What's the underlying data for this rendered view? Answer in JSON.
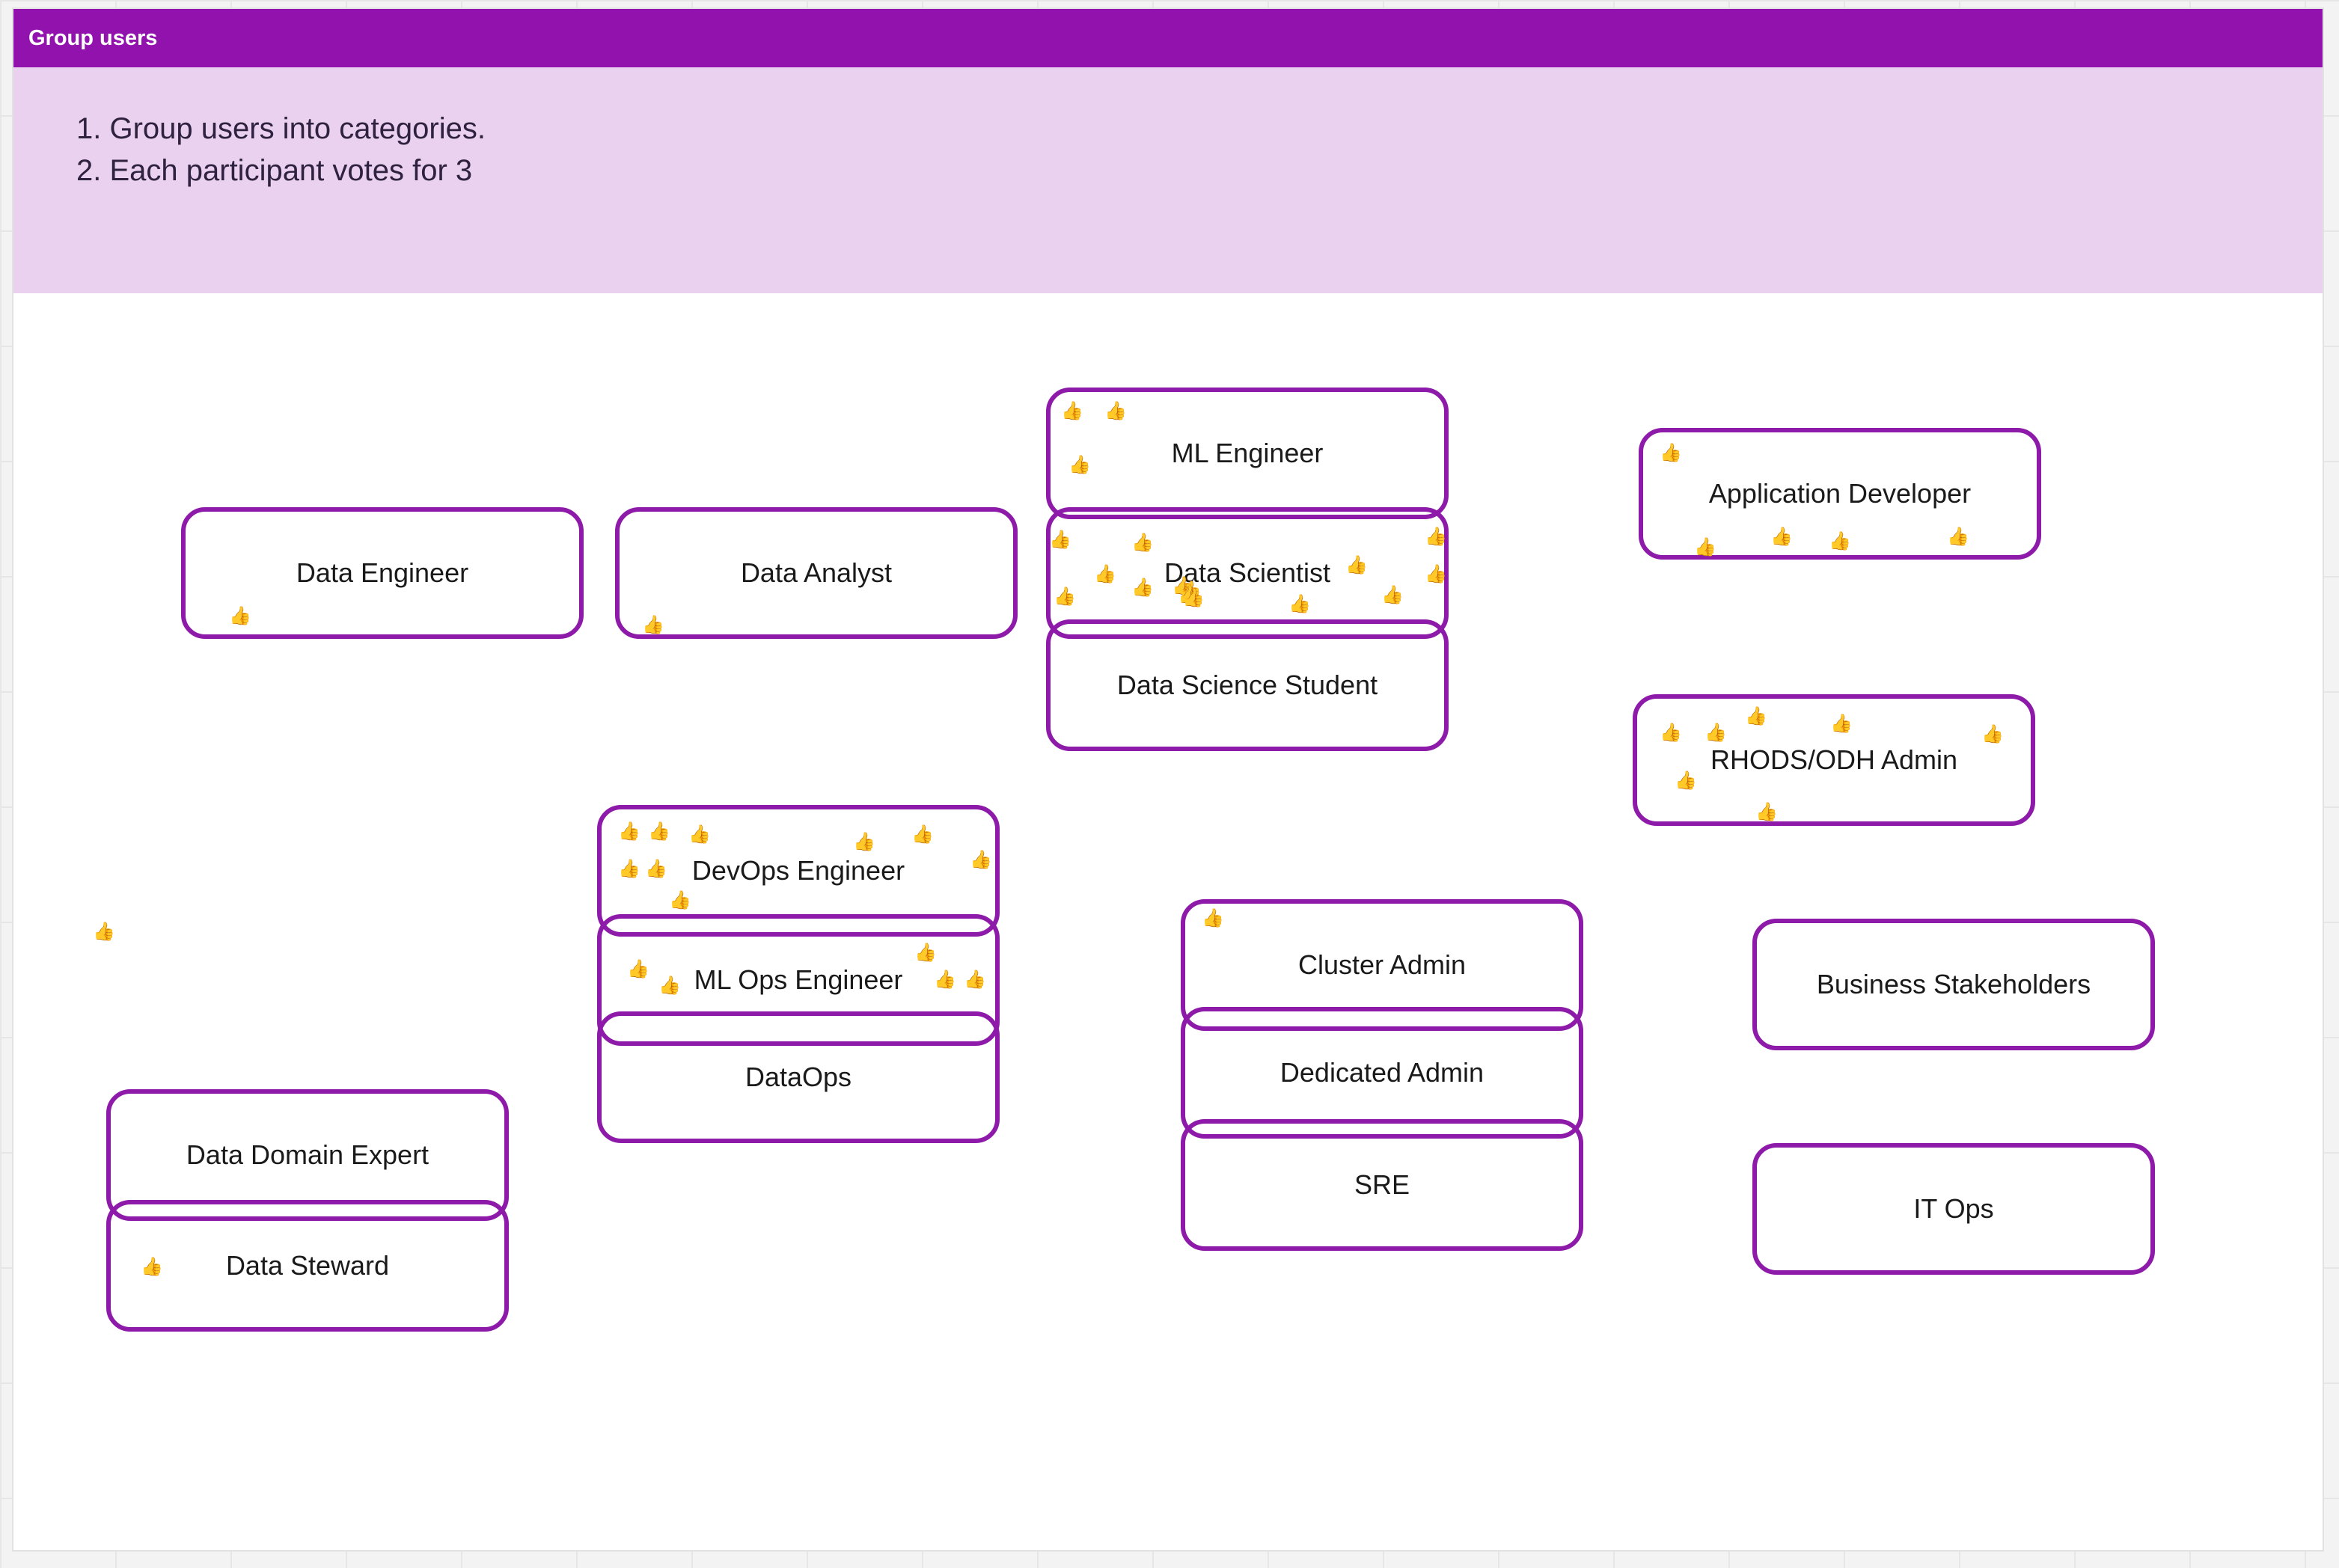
{
  "frame": {
    "title": "Group users",
    "instructions": [
      "1. Group users into categories.",
      "2. Each participant votes for 3"
    ]
  },
  "cards": [
    {
      "id": "data-engineer",
      "label": "Data Engineer",
      "votes": 1
    },
    {
      "id": "data-analyst",
      "label": "Data Analyst",
      "votes": 1
    },
    {
      "id": "ml-engineer",
      "label": "ML Engineer",
      "votes": 3
    },
    {
      "id": "data-scientist",
      "label": "Data Scientist",
      "votes": 14
    },
    {
      "id": "data-science-student",
      "label": "Data Science Student",
      "votes": 0
    },
    {
      "id": "application-developer",
      "label": "Application Developer",
      "votes": 5
    },
    {
      "id": "rhods-odh-admin",
      "label": "RHODS/ODH Admin",
      "votes": 7
    },
    {
      "id": "devops-engineer",
      "label": "DevOps Engineer",
      "votes": 9
    },
    {
      "id": "ml-ops-engineer",
      "label": "ML Ops Engineer",
      "votes": 5
    },
    {
      "id": "dataops",
      "label": "DataOps",
      "votes": 0
    },
    {
      "id": "cluster-admin",
      "label": "Cluster Admin",
      "votes": 1
    },
    {
      "id": "dedicated-admin",
      "label": "Dedicated Admin",
      "votes": 0
    },
    {
      "id": "sre",
      "label": "SRE",
      "votes": 0
    },
    {
      "id": "business-stakeholders",
      "label": "Business Stakeholders",
      "votes": 0
    },
    {
      "id": "it-ops",
      "label": "IT Ops",
      "votes": 0
    },
    {
      "id": "data-domain-expert",
      "label": "Data Domain Expert",
      "votes": 0
    },
    {
      "id": "data-steward",
      "label": "Data Steward",
      "votes": 1
    }
  ],
  "loose_votes": 1,
  "vote_icon": "thumbs-up-icon",
  "vote_glyph": "👍",
  "colors": {
    "header": "#9112ad",
    "instructions_bg": "#ead1ef",
    "card_border": "#8d1aa8"
  }
}
